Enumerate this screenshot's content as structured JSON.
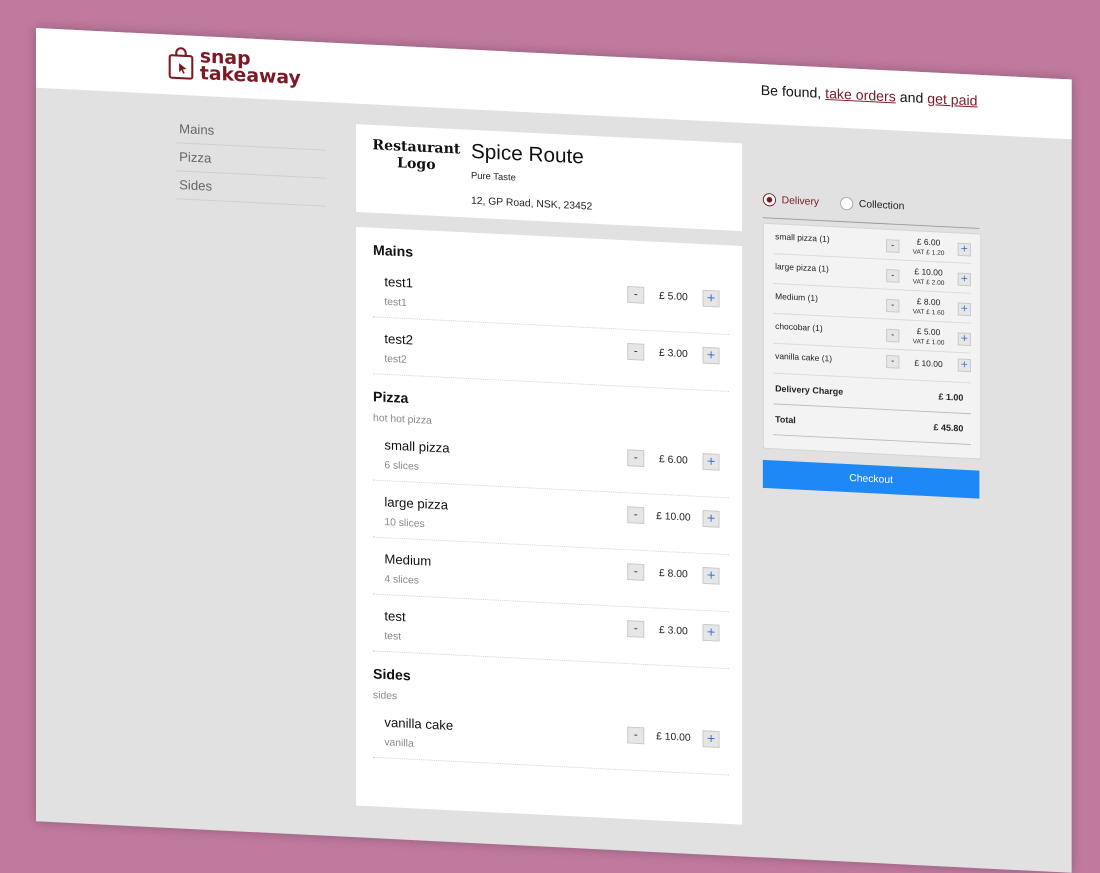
{
  "brand": {
    "line1": "snap",
    "line2": "takeaway",
    "color": "#7b1a26"
  },
  "tagline": {
    "prefix": "Be found, ",
    "link1": "take orders",
    "middle": " and ",
    "link2": "get paid"
  },
  "categories": [
    "Mains",
    "Pizza",
    "Sides"
  ],
  "restaurant": {
    "logo_text": "Restaurant Logo",
    "name": "Spice Route",
    "tagline": "Pure Taste",
    "address": "12, GP Road, NSK, 23452"
  },
  "menu": {
    "mains": {
      "title": "Mains",
      "items": [
        {
          "name": "test1",
          "desc": "test1",
          "price": "£ 5.00"
        },
        {
          "name": "test2",
          "desc": "test2",
          "price": "£ 3.00"
        }
      ]
    },
    "pizza": {
      "title": "Pizza",
      "subtitle": "hot hot pizza",
      "items": [
        {
          "name": "small pizza",
          "desc": "6 slices",
          "price": "£ 6.00"
        },
        {
          "name": "large pizza",
          "desc": "10 slices",
          "price": "£ 10.00"
        },
        {
          "name": "Medium",
          "desc": "4 slices",
          "price": "£ 8.00"
        },
        {
          "name": "test",
          "desc": "test",
          "price": "£ 3.00"
        }
      ]
    },
    "sides": {
      "title": "Sides",
      "subtitle": "sides",
      "items": [
        {
          "name": "vanilla cake",
          "desc": "vanilla",
          "price": "£ 10.00"
        }
      ]
    },
    "minus_label": "-",
    "plus_label": "+"
  },
  "order_type": {
    "delivery": "Delivery",
    "collection": "Collection",
    "selected": "delivery"
  },
  "basket": {
    "lines": [
      {
        "name": "small pizza (1)",
        "price": "£ 6.00",
        "vat": "VAT £ 1.20"
      },
      {
        "name": "large pizza (1)",
        "price": "£ 10.00",
        "vat": "VAT £ 2.00"
      },
      {
        "name": "Medium (1)",
        "price": "£ 8.00",
        "vat": "VAT £ 1.60"
      },
      {
        "name": "chocobar (1)",
        "price": "£ 5.00",
        "vat": "VAT £ 1.00"
      },
      {
        "name": "vanilla cake (1)",
        "price": "£ 10.00",
        "vat": ""
      }
    ],
    "delivery_label": "Delivery Charge",
    "delivery_value": "£   1.00",
    "total_label": "Total",
    "total_value": "£ 45.80"
  },
  "checkout_label": "Checkout",
  "colors": {
    "background": "#c07a9e",
    "checkout": "#1e88f6",
    "brand": "#7b1a26"
  }
}
